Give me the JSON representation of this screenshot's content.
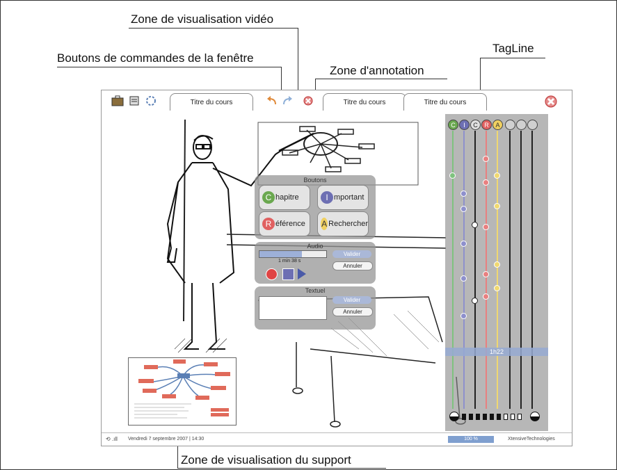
{
  "callouts": {
    "video_zone": "Zone de visualisation vidéo",
    "window_buttons": "Boutons de commandes de la fenêtre",
    "annotation_zone": "Zone d'annotation",
    "tagline": "TagLine",
    "support_zone": "Zone de visualisation du support"
  },
  "tabs": [
    {
      "label": "Titre du cours"
    },
    {
      "label": "Titre du cours"
    },
    {
      "label": "Titre du cours"
    }
  ],
  "buttons_panel": {
    "title": "Boutons",
    "chapitre": {
      "letter": "C",
      "rest": "hapitre",
      "color": "#6aa84f"
    },
    "important": {
      "letter": "I",
      "rest": "mportant",
      "color": "#6d6fb3"
    },
    "reference": {
      "letter": "R",
      "rest": "éférence",
      "color": "#e06060"
    },
    "rechercher": {
      "letter": "A",
      "rest": "Rechercher",
      "color": "#f0d060"
    }
  },
  "audio_panel": {
    "title": "Audio",
    "time": "1 min 38 s",
    "progress": 0.64,
    "validate": "Valider",
    "cancel": "Annuler"
  },
  "text_panel": {
    "title": "Textuel",
    "validate": "Valider",
    "cancel": "Annuler"
  },
  "tagline": {
    "time_marker": "1h22",
    "heads": [
      {
        "letter": "C",
        "color": "#6aa84f"
      },
      {
        "letter": "I",
        "color": "#6d6fb3"
      },
      {
        "letter": "C",
        "color": "#e0e0e0"
      },
      {
        "letter": "R",
        "color": "#e06060"
      },
      {
        "letter": "A",
        "color": "#f0d060"
      },
      {
        "letter": "",
        "color": "#d0d0d0"
      },
      {
        "letter": "",
        "color": "#d0d0d0"
      },
      {
        "letter": "",
        "color": "#d0d0d0"
      }
    ]
  },
  "statusbar": {
    "date": "Vendredi 7 septembre 2007 | 14:30",
    "zoom": "100 %",
    "brand": "XtensiveTechnologies"
  }
}
